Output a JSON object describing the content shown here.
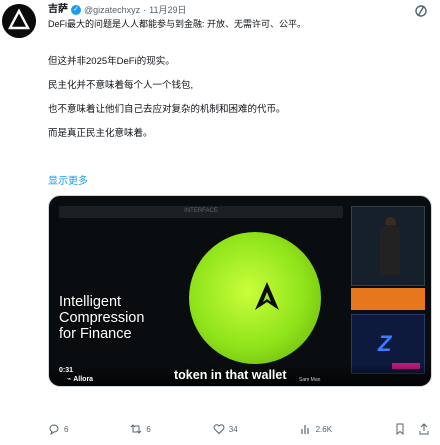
{
  "author": {
    "name": "吉萨",
    "handle": "@gizatechxyz",
    "date": "11月29日",
    "tagline": "DeFi最大的问题是人人都能参与到金融: 开放、无需许可、公平。"
  },
  "post": {
    "lines": [
      "但这并非2025年DeFi的现实。",
      "民主化并不意味着每个人一个钱包,",
      "也不意味着让他们自己去应对复杂的机制和困难的代币。",
      "而是真正民主化意味着。"
    ],
    "show_more": "显示更多"
  },
  "video": {
    "top_bar_label": "INTERFACE",
    "overlay_title": [
      "Intelligent",
      "Compression",
      "for Finance"
    ],
    "time": "0:31",
    "brand": "Allora",
    "caption": "token in that wallet",
    "caption_small": "Sam Man",
    "orb_color": "#8fe31a"
  },
  "actions": {
    "replies": "6",
    "reposts": "6",
    "likes": "34",
    "views": "2.6K"
  },
  "colors": {
    "accent": "#1d9bf0",
    "muted": "#536471"
  }
}
